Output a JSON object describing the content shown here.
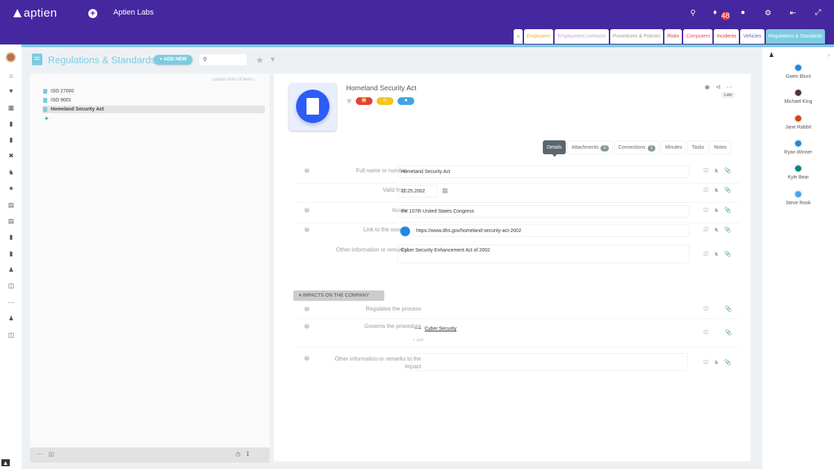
{
  "app": {
    "logo": "aptien",
    "org": "Aptien Labs",
    "notifications": "48"
  },
  "tabs": [
    {
      "label": "Employees",
      "color": "#f5b800"
    },
    {
      "label": "Employment contracts",
      "color": "#c89ee0"
    },
    {
      "label": "Procedures & Policies",
      "color": "#999999"
    },
    {
      "label": "Risks",
      "color": "#e53935"
    },
    {
      "label": "Computers",
      "color": "#ec407a"
    },
    {
      "label": "Incidents",
      "color": "#e53935"
    },
    {
      "label": "Vehicles",
      "color": "#5c6bc0"
    },
    {
      "label": "Regulations & Standards",
      "color": "#ffffff"
    }
  ],
  "header": {
    "title": "Regulations & Standards",
    "add_new": "+ ADD NEW",
    "search_placeholder": ""
  },
  "tree": {
    "custom_order": "custom order of items",
    "items": [
      "ISO 27000",
      "ISO 9001",
      "Homeland Security Act"
    ]
  },
  "record": {
    "title": "Homeland Security Act",
    "type": "Law"
  },
  "detail_tabs": [
    {
      "label": "Details"
    },
    {
      "label": "Attachments",
      "count": "1"
    },
    {
      "label": "Connections",
      "count": "1"
    },
    {
      "label": "Minutes"
    },
    {
      "label": "Tasks"
    },
    {
      "label": "Notes"
    }
  ],
  "fields": [
    {
      "label": "Full name or number",
      "value": "Homeland Security Act"
    },
    {
      "label": "Valid from",
      "value": "11.25.2002"
    },
    {
      "label": "Issuer",
      "value": "the 107th United States Congress"
    },
    {
      "label": "Link to the source",
      "value": "https://www.dhs.gov/homeland-security-act-2002"
    },
    {
      "label": "Other information or remarks",
      "value": "Cyber Security Enhancement Act of 2002"
    }
  ],
  "impacts": {
    "section": "IMPACTS ON THE COMPANY",
    "regulates": "Regulates the process",
    "governs": "Governs the procedure",
    "governs_link": "Cyber Security",
    "add": "+ add",
    "remarks": "Other information or remarks to the impact"
  },
  "people": [
    {
      "name": "Gwen Blunt",
      "color": "#1e88e5"
    },
    {
      "name": "Michael King",
      "color": "#4e342e"
    },
    {
      "name": "Jane Rabbit",
      "color": "#d84315"
    },
    {
      "name": "Ryan Winner",
      "color": "#1e88e5"
    },
    {
      "name": "Kyle Bear",
      "color": "#00897b"
    },
    {
      "name": "Steve Rook",
      "color": "#42a5f5"
    }
  ]
}
